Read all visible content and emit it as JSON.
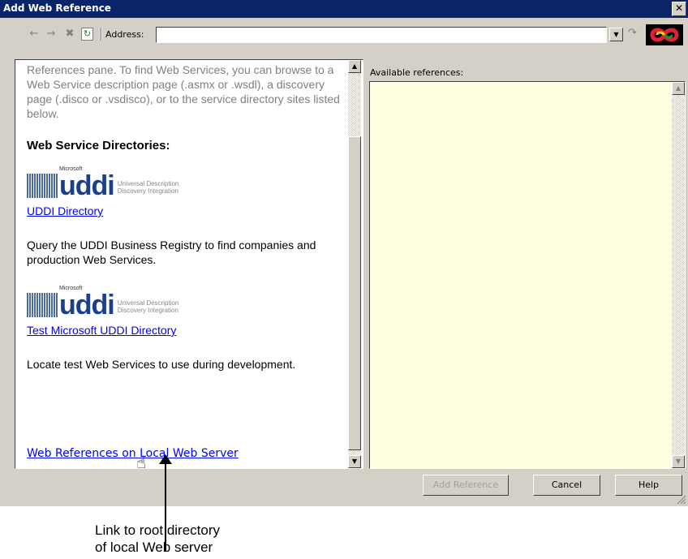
{
  "window": {
    "title": "Add Web Reference",
    "close_glyph": "✕"
  },
  "toolbar": {
    "back_glyph": "←",
    "forward_glyph": "→",
    "stop_glyph": "✖",
    "refresh_glyph": "↻",
    "address_label": "Address:",
    "address_value": "",
    "dropdown_glyph": "▼",
    "go_glyph": "↷"
  },
  "left_pane": {
    "intro_text": "References pane. To find Web Services, you can browse to a Web Service description page (.asmx or .wsdl), a discovery page (.disco or .vsdisco), or to the service directory sites listed below.",
    "directories_heading": "Web Service Directories:",
    "uddi_logo": {
      "brand": "Microsoft",
      "word": "uddi",
      "tagline": "Universal Description Discovery Integration"
    },
    "entries": [
      {
        "link": "UDDI Directory",
        "description": "Query the UDDI Business Registry to find companies and production Web Services."
      },
      {
        "link": "Test Microsoft UDDI Directory",
        "description": "Locate test Web Services to use during development."
      }
    ],
    "local_link": "Web References on Local Web Server",
    "scroll_up_glyph": "▲",
    "scroll_down_glyph": "▼"
  },
  "right_pane": {
    "label": "Available references:",
    "scroll_up_glyph": "▲",
    "scroll_down_glyph": "▼"
  },
  "buttons": {
    "add_reference": "Add Reference",
    "cancel": "Cancel",
    "help": "Help"
  },
  "cursor_glyph": "☝",
  "caption": {
    "line1": "Link to root directory",
    "line2": "of local Web server"
  },
  "colors": {
    "titlebar": "#0a246a",
    "window": "#d4d0c8",
    "link": "#0000ff",
    "references_bg": "#ffffe1",
    "logo_blue": "#1c3f8a"
  }
}
